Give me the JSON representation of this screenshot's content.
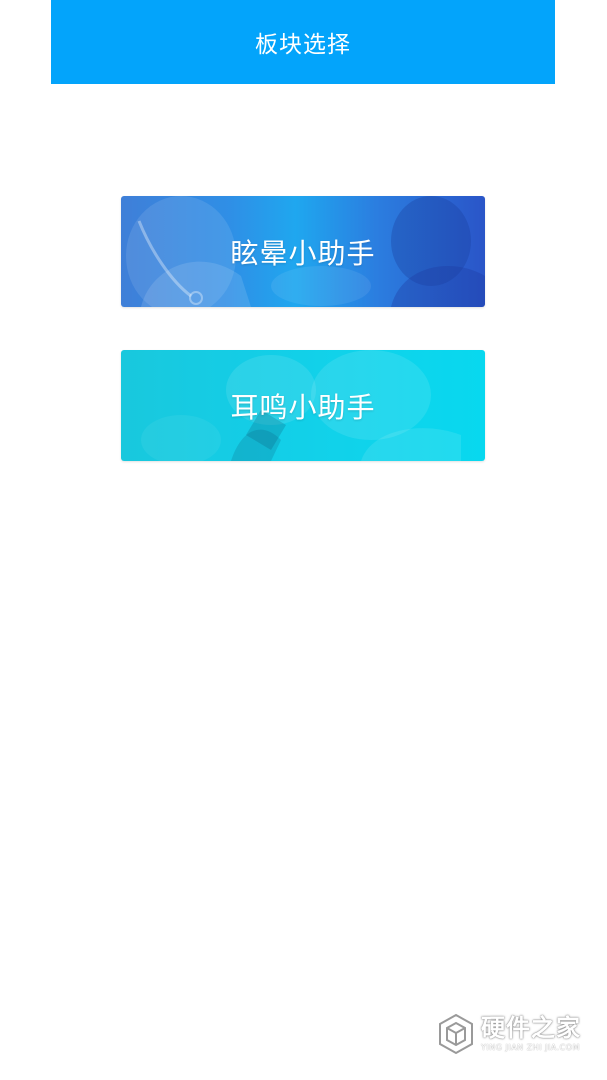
{
  "header": {
    "title": "板块选择",
    "bg_color": "#03a4fb"
  },
  "modules": [
    {
      "label": "眩晕小助手",
      "theme": "dizzy"
    },
    {
      "label": "耳鸣小助手",
      "theme": "tinnitus"
    }
  ],
  "watermark": {
    "icon": "hexagon-logo-icon",
    "main": "硬件之家",
    "sub": "YING JIAN ZHI JIA.COM"
  }
}
